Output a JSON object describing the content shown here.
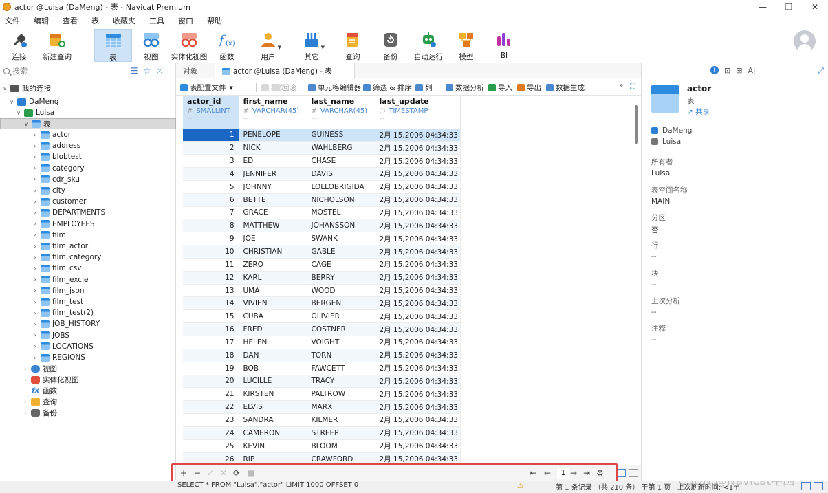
{
  "window": {
    "title": "actor @Luisa (DaMeng) - 表 - Navicat Premium",
    "controls": [
      "—",
      "❐",
      "✕"
    ]
  },
  "menu": [
    "文件",
    "编辑",
    "查看",
    "表",
    "收藏夹",
    "工具",
    "窗口",
    "帮助"
  ],
  "toolbar": [
    {
      "label": "连接",
      "icon": "connect-icon"
    },
    {
      "label": "新建查询",
      "icon": "new-query-icon"
    },
    {
      "label": "表",
      "icon": "table-icon",
      "active": true
    },
    {
      "label": "视图",
      "icon": "view-icon"
    },
    {
      "label": "实体化视图",
      "icon": "materialized-view-icon"
    },
    {
      "label": "函数",
      "icon": "function-icon"
    },
    {
      "label": "用户",
      "icon": "user-icon"
    },
    {
      "label": "其它",
      "icon": "others-icon"
    },
    {
      "label": "查询",
      "icon": "query-icon"
    },
    {
      "label": "备份",
      "icon": "backup-icon"
    },
    {
      "label": "自动运行",
      "icon": "automation-icon"
    },
    {
      "label": "模型",
      "icon": "model-icon"
    },
    {
      "label": "BI",
      "icon": "bi-icon"
    }
  ],
  "sidebar": {
    "search_placeholder": "搜索",
    "root": "我的连接",
    "connection": "DaMeng",
    "schema": "Luisa",
    "tables_folder": "表",
    "tables": [
      "actor",
      "address",
      "blobtest",
      "category",
      "cdr_sku",
      "city",
      "customer",
      "DEPARTMENTS",
      "EMPLOYEES",
      "film",
      "film_actor",
      "film_category",
      "film_csv",
      "film_excle",
      "film_json",
      "film_test",
      "film_test(2)",
      "JOB_HISTORY",
      "JOBS",
      "LOCATIONS",
      "REGIONS"
    ],
    "other_folders": [
      "视图",
      "实体化视图",
      "函数",
      "查询",
      "备份"
    ]
  },
  "tabs": {
    "objects": "对象",
    "active": "actor @Luisa (DaMeng) - 表"
  },
  "grid_toolbar": {
    "table_config": "表配置文件",
    "commit": "提交",
    "rollback": "回滚",
    "cell_editor": "单元格编辑器",
    "filter_sort": "筛选 & 排序",
    "columns": "列",
    "data_analysis": "数据分析",
    "import": "导入",
    "export": "导出",
    "data_gen": "数据生成"
  },
  "columns": [
    {
      "name": "actor_id",
      "type": "SMALLINT",
      "type_sym": "#",
      "default": "--"
    },
    {
      "name": "first_name",
      "type": "VARCHAR(45)",
      "type_sym": "#",
      "default": "--"
    },
    {
      "name": "last_name",
      "type": "VARCHAR(45)",
      "type_sym": "#",
      "default": "--"
    },
    {
      "name": "last_update",
      "type": "TIMESTAMP",
      "type_sym": "◷",
      "default": "--"
    }
  ],
  "rows": [
    [
      "1",
      "PENELOPE",
      "GUINESS",
      "2月 15,2006 04:34:33 AM"
    ],
    [
      "2",
      "NICK",
      "WAHLBERG",
      "2月 15,2006 04:34:33 AM"
    ],
    [
      "3",
      "ED",
      "CHASE",
      "2月 15,2006 04:34:33 AM"
    ],
    [
      "4",
      "JENNIFER",
      "DAVIS",
      "2月 15,2006 04:34:33 AM"
    ],
    [
      "5",
      "JOHNNY",
      "LOLLOBRIGIDA",
      "2月 15,2006 04:34:33 AM"
    ],
    [
      "6",
      "BETTE",
      "NICHOLSON",
      "2月 15,2006 04:34:33 AM"
    ],
    [
      "7",
      "GRACE",
      "MOSTEL",
      "2月 15,2006 04:34:33 AM"
    ],
    [
      "8",
      "MATTHEW",
      "JOHANSSON",
      "2月 15,2006 04:34:33 AM"
    ],
    [
      "9",
      "JOE",
      "SWANK",
      "2月 15,2006 04:34:33 AM"
    ],
    [
      "10",
      "CHRISTIAN",
      "GABLE",
      "2月 15,2006 04:34:33 AM"
    ],
    [
      "11",
      "ZERO",
      "CAGE",
      "2月 15,2006 04:34:33 AM"
    ],
    [
      "12",
      "KARL",
      "BERRY",
      "2月 15,2006 04:34:33 AM"
    ],
    [
      "13",
      "UMA",
      "WOOD",
      "2月 15,2006 04:34:33 AM"
    ],
    [
      "14",
      "VIVIEN",
      "BERGEN",
      "2月 15,2006 04:34:33 AM"
    ],
    [
      "15",
      "CUBA",
      "OLIVIER",
      "2月 15,2006 04:34:33 AM"
    ],
    [
      "16",
      "FRED",
      "COSTNER",
      "2月 15,2006 04:34:33 AM"
    ],
    [
      "17",
      "HELEN",
      "VOIGHT",
      "2月 15,2006 04:34:33 AM"
    ],
    [
      "18",
      "DAN",
      "TORN",
      "2月 15,2006 04:34:33 AM"
    ],
    [
      "19",
      "BOB",
      "FAWCETT",
      "2月 15,2006 04:34:33 AM"
    ],
    [
      "20",
      "LUCILLE",
      "TRACY",
      "2月 15,2006 04:34:33 AM"
    ],
    [
      "21",
      "KIRSTEN",
      "PALTROW",
      "2月 15,2006 04:34:33 AM"
    ],
    [
      "22",
      "ELVIS",
      "MARX",
      "2月 15,2006 04:34:33 AM"
    ],
    [
      "23",
      "SANDRA",
      "KILMER",
      "2月 15,2006 04:34:33 AM"
    ],
    [
      "24",
      "CAMERON",
      "STREEP",
      "2月 15,2006 04:34:33 AM"
    ],
    [
      "25",
      "KEVIN",
      "BLOOM",
      "2月 15,2006 04:34:33 AM"
    ],
    [
      "26",
      "RIP",
      "CRAWFORD",
      "2月 15,2006 04:34:33 AM"
    ]
  ],
  "nav": {
    "add": "+",
    "remove": "−",
    "apply": "✓",
    "discard": "✕",
    "refresh": "⟳",
    "stop": "■",
    "first": "⇤",
    "prev": "←",
    "page": "1",
    "next": "→",
    "last": "⇥",
    "settings": "⚙"
  },
  "status": {
    "sql": "SELECT * FROM \"Luisa\".\"actor\" LIMIT 1000 OFFSET 0",
    "record": "第 1 条记录 （共 210 条） 于第 1 页",
    "refresh": "上次刷新时间: <1m",
    "watermark": "CSDN @Navicat中国"
  },
  "info_panel": {
    "name": "actor",
    "type": "表",
    "share": "共享",
    "connection": "DaMeng",
    "schema": "Luisa",
    "props": [
      {
        "k": "所有者",
        "v": "Luisa"
      },
      {
        "k": "表空间名称",
        "v": "MAIN"
      },
      {
        "k": "分区",
        "v": "否"
      },
      {
        "k": "行",
        "v": "--"
      },
      {
        "k": "块",
        "v": "--"
      },
      {
        "k": "上次分析",
        "v": "--"
      },
      {
        "k": "注释",
        "v": "--"
      }
    ]
  }
}
